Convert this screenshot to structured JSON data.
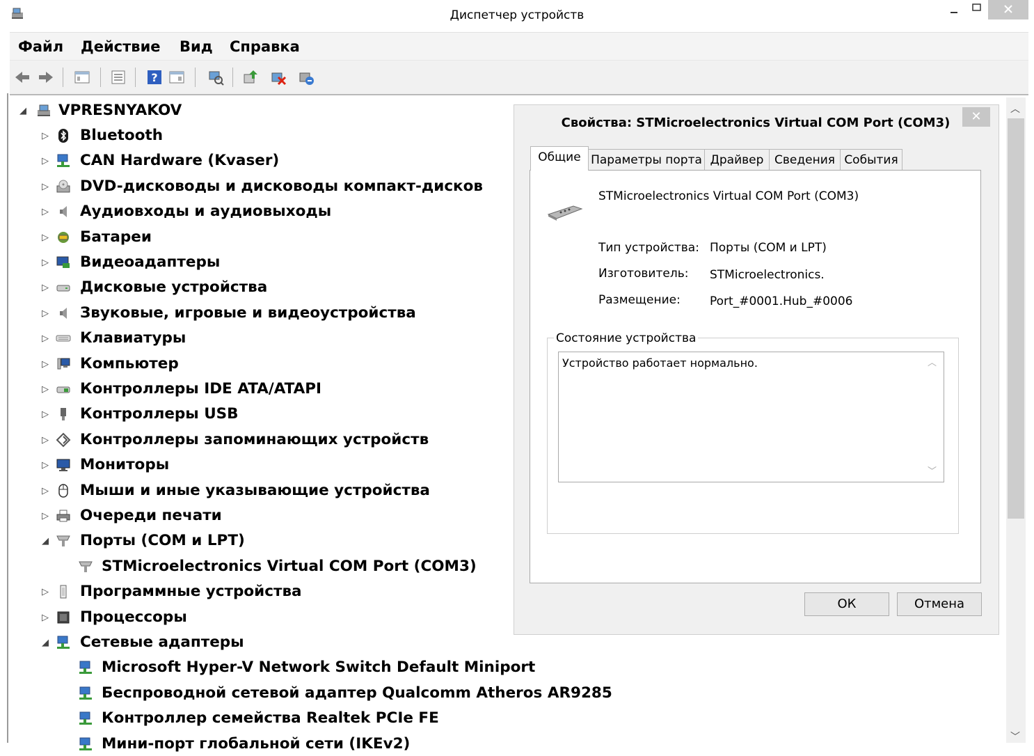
{
  "window": {
    "title": "Диспетчер устройств"
  },
  "menu": [
    "Файл",
    "Действие",
    "Вид",
    "Справка"
  ],
  "toolbar_icons": [
    "back-icon",
    "forward-icon",
    "console-tree-icon",
    "properties-icon",
    "help-icon",
    "action-pane-icon",
    "scan-hardware-icon",
    "update-driver-icon",
    "disable-device-icon",
    "uninstall-device-icon"
  ],
  "tree": {
    "root": "VPRESNYAKOV",
    "items": [
      {
        "label": "Bluetooth",
        "icon": "bluetooth-icon",
        "state": "collapsed"
      },
      {
        "label": "CAN Hardware (Kvaser)",
        "icon": "network-icon",
        "state": "collapsed"
      },
      {
        "label": "DVD-дисководы и дисководы компакт-дисков",
        "icon": "dvd-icon",
        "state": "collapsed"
      },
      {
        "label": "Аудиовходы и аудиовыходы",
        "icon": "speaker-icon",
        "state": "collapsed"
      },
      {
        "label": "Батареи",
        "icon": "battery-icon",
        "state": "collapsed"
      },
      {
        "label": "Видеоадаптеры",
        "icon": "display-adapter-icon",
        "state": "collapsed"
      },
      {
        "label": "Дисковые устройства",
        "icon": "disk-icon",
        "state": "collapsed"
      },
      {
        "label": "Звуковые, игровые и видеоустройства",
        "icon": "speaker-icon",
        "state": "collapsed"
      },
      {
        "label": "Клавиатуры",
        "icon": "keyboard-icon",
        "state": "collapsed"
      },
      {
        "label": "Компьютер",
        "icon": "computer-icon",
        "state": "collapsed"
      },
      {
        "label": "Контроллеры IDE ATA/ATAPI",
        "icon": "ide-icon",
        "state": "collapsed"
      },
      {
        "label": "Контроллеры USB",
        "icon": "usb-icon",
        "state": "collapsed"
      },
      {
        "label": "Контроллеры запоминающих устройств",
        "icon": "storage-icon",
        "state": "collapsed"
      },
      {
        "label": "Мониторы",
        "icon": "monitor-icon",
        "state": "collapsed"
      },
      {
        "label": "Мыши и иные указывающие устройства",
        "icon": "mouse-icon",
        "state": "collapsed"
      },
      {
        "label": "Очереди печати",
        "icon": "printer-icon",
        "state": "collapsed"
      },
      {
        "label": "Порты (COM и LPT)",
        "icon": "port-icon",
        "state": "expanded"
      },
      {
        "label": "STMicroelectronics Virtual COM Port (COM3)",
        "icon": "port-icon",
        "state": "child"
      },
      {
        "label": "Программные устройства",
        "icon": "software-device-icon",
        "state": "collapsed"
      },
      {
        "label": "Процессоры",
        "icon": "processor-icon",
        "state": "collapsed"
      },
      {
        "label": "Сетевые адаптеры",
        "icon": "network-icon",
        "state": "expanded"
      },
      {
        "label": "Microsoft Hyper-V Network Switch Default Miniport",
        "icon": "network-icon",
        "state": "child"
      },
      {
        "label": "Беспроводной сетевой адаптер Qualcomm Atheros AR9285",
        "icon": "network-icon",
        "state": "child"
      },
      {
        "label": "Контроллер семейства Realtek PCIe FE",
        "icon": "network-icon",
        "state": "child"
      },
      {
        "label": "Мини-порт глобальной сети (IKEv2)",
        "icon": "network-icon",
        "state": "child"
      }
    ]
  },
  "dialog": {
    "title": "Свойства: STMicroelectronics Virtual COM Port (COM3)",
    "tabs": [
      "Общие",
      "Параметры порта",
      "Драйвер",
      "Сведения",
      "События"
    ],
    "active_tab": "Общие",
    "device_name": "STMicroelectronics Virtual COM Port (COM3)",
    "properties": [
      {
        "label": "Тип устройства:",
        "value": "Порты (COM и LPT)"
      },
      {
        "label": "Изготовитель:",
        "value": "STMicroelectronics."
      },
      {
        "label": "Размещение:",
        "value": "Port_#0001.Hub_#0006"
      }
    ],
    "status_legend": "Состояние устройства",
    "status_text": "Устройство работает нормально.",
    "ok_label": "ОК",
    "cancel_label": "Отмена"
  }
}
